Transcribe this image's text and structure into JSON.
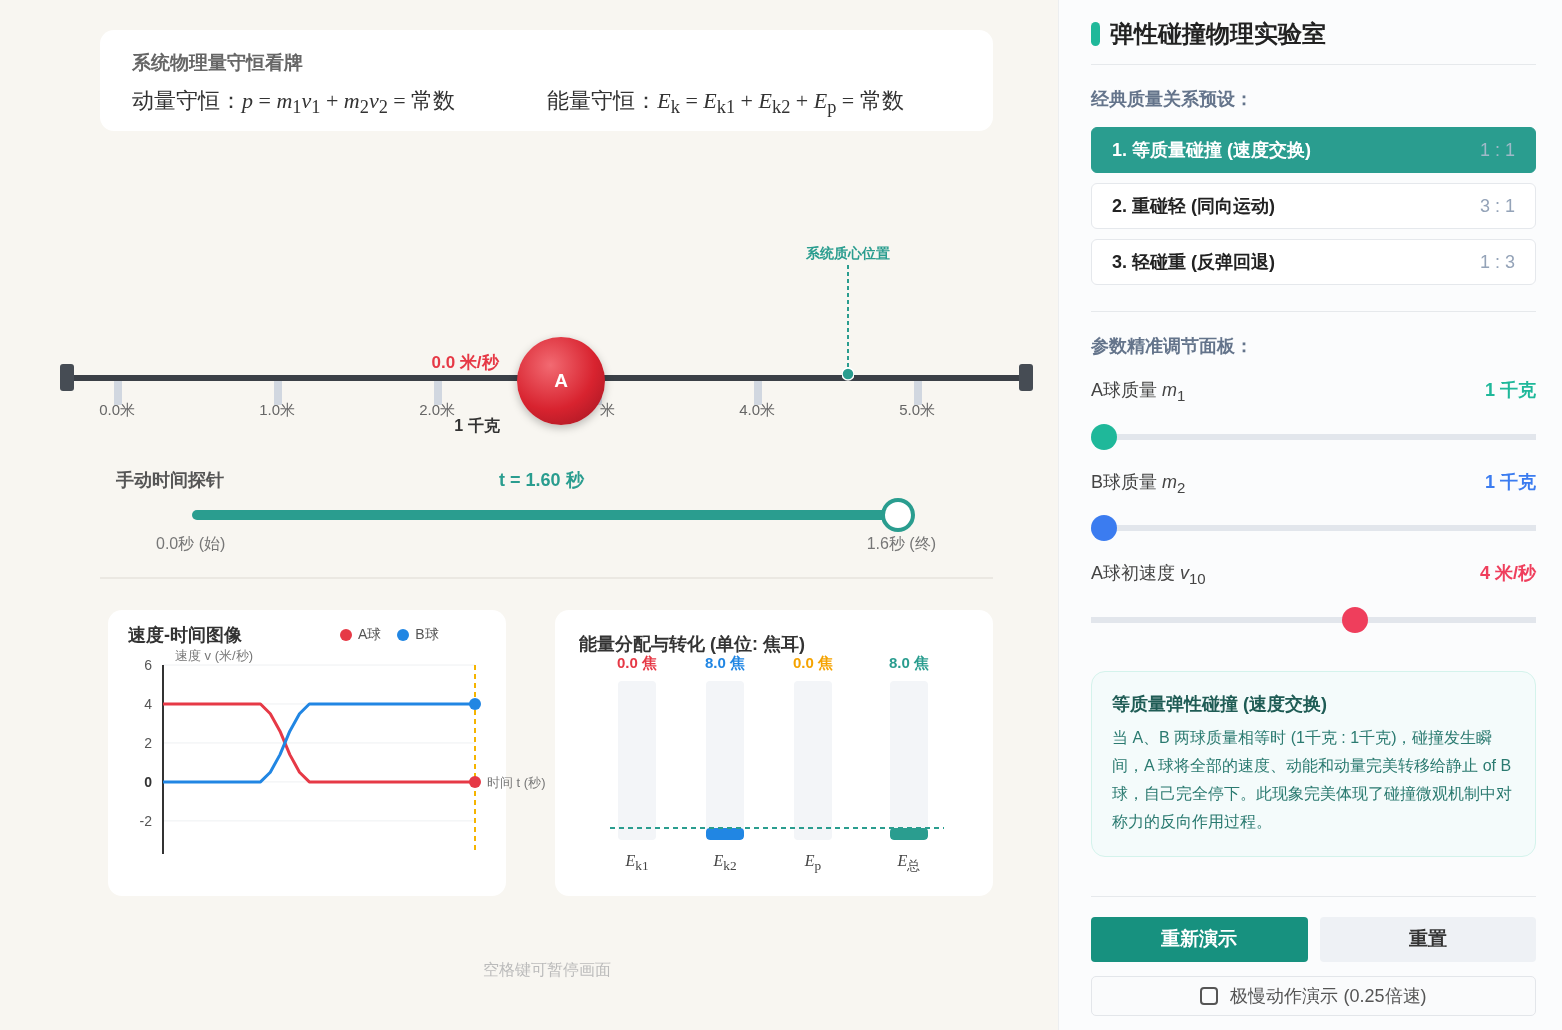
{
  "conservation_board": {
    "title": "系统物理量守恒看牌",
    "formulas": [
      "动量守恒：*p* = *m*$_{1}$*v*$_{1}$ + *m*$_{2}$*v*$_{2}$ = 常数",
      "能量守恒：*E*$_{k}$ = *E*$_{k1}$ + *E*$_{k2}$ + *E*$_{p}$ = 常数"
    ]
  },
  "track": {
    "tick_labels": [
      "0.0米",
      "1.0米",
      "2.0米",
      "米",
      "4.0米",
      "5.0米"
    ],
    "center_of_mass_label": "系统质心位置",
    "ball": {
      "label": "A",
      "velocity": "0.0 米/秒",
      "mass": "1 千克"
    }
  },
  "time_probe": {
    "label": "手动时间探针",
    "reading": "t = 1.60 秒",
    "level": 1,
    "start": "0.0秒 (始)",
    "end": "1.6秒 (终)"
  },
  "velocity_chart": {
    "title": "速度-时间图像",
    "chart_data": {
      "type": "line",
      "ylabel": "速度 v (米/秒)",
      "xlabel": "时间 t (秒)",
      "categories": [
        null,
        null,
        null,
        null,
        null,
        null,
        null,
        null,
        null,
        null,
        null,
        null,
        null,
        null,
        null,
        null,
        null,
        null,
        null,
        null,
        null,
        null,
        null,
        null,
        null,
        null,
        null,
        null,
        null,
        null,
        null,
        null,
        null
      ],
      "yticks": [
        6,
        4,
        2,
        0,
        -2
      ],
      "grid": true,
      "ylim": [
        -3.7,
        6
      ],
      "series": [
        {
          "name": "A球",
          "color": "#e63946",
          "values": [
            4,
            4,
            4,
            4,
            4,
            4,
            4,
            4,
            4,
            4,
            4,
            3.5,
            2.6,
            1.4,
            0.5,
            0,
            0,
            0,
            0,
            0,
            0,
            0,
            0,
            0,
            0,
            0,
            0,
            0,
            0,
            0,
            0,
            0,
            0
          ]
        },
        {
          "name": "B球",
          "color": "#2186e3",
          "values": [
            0,
            0,
            0,
            0,
            0,
            0,
            0,
            0,
            0,
            0,
            0,
            0.5,
            1.4,
            2.6,
            3.5,
            4,
            4,
            4,
            4,
            4,
            4,
            4,
            4,
            4,
            4,
            4,
            4,
            4,
            4,
            4,
            4,
            4,
            4
          ]
        }
      ]
    }
  },
  "energy_chart": {
    "title": "能量分配与转化 (单位: 焦耳)",
    "bars": [
      {
        "value": "0.0 焦",
        "label": "*E*$_{k1}$",
        "color": "#e63946",
        "filled": false
      },
      {
        "value": "8.0 焦",
        "label": "*E*$_{k2}$",
        "color": "#2186e3",
        "filled": true
      },
      {
        "value": "0.0 焦",
        "label": "*E*$_{p}$",
        "color": "#f5a300",
        "filled": false
      },
      {
        "value": "8.0 焦",
        "label": "*E*$_{总}$",
        "color": "#2a9d8f",
        "filled": true
      }
    ]
  },
  "hint": "空格键可暂停画面",
  "sidebar": {
    "title": "弹性碰撞物理实验室",
    "presets_label": "经典质量关系预设：",
    "presets": [
      {
        "label": "1. 等质量碰撞 (速度交换)",
        "ratio": "1 : 1",
        "selected": true
      },
      {
        "label": "2. 重碰轻 (同向运动)",
        "ratio": "3 : 1",
        "selected": false
      },
      {
        "label": "3. 轻碰重 (反弹回退)",
        "ratio": "1 : 3",
        "selected": false
      }
    ],
    "params_label": "参数精准调节面板：",
    "sliders": [
      {
        "label": "A球质量 *m*$_{1}$",
        "value": "1 千克",
        "color": "#1fb89a",
        "level": 0
      },
      {
        "label": "B球质量 *m*$_{2}$",
        "value": "1 千克",
        "color": "#3b7cf0",
        "level": 0
      },
      {
        "label": "A球初速度 *v*$_{10}$",
        "value": "4 米/秒",
        "color": "#ef3e5c",
        "level": 0.6
      }
    ],
    "info": {
      "title": "等质量弹性碰撞 (速度交换)",
      "text": "当 A、B 两球质量相等时 (1千克 : 1千克)，碰撞发生瞬间，A 球将全部的速度、动能和动量完美转移给静止 of B 球，自己完全停下。此现象完美体现了碰撞微观机制中对称力的反向作用过程。"
    },
    "buttons": [
      "重新演示",
      "重置"
    ],
    "slow_motion": {
      "label": "极慢动作演示 (0.25倍速)",
      "checked": false
    }
  }
}
